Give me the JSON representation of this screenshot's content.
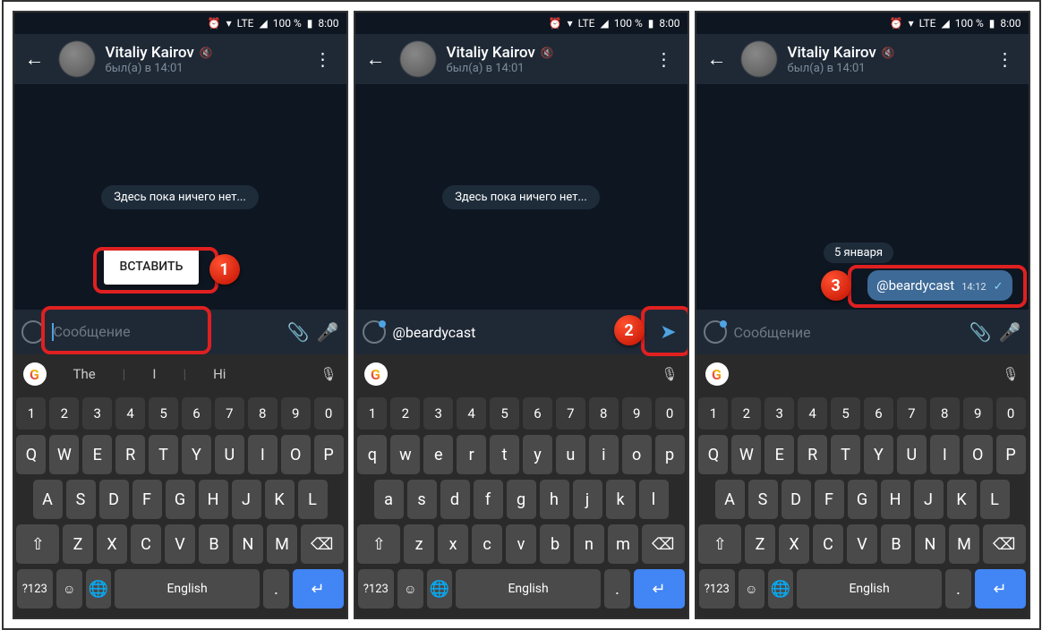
{
  "status": {
    "time": "8:00",
    "battery": "100 %",
    "net": "LTE"
  },
  "header": {
    "name": "Vitaliy Kairov",
    "seen": "был(а) в 14:01"
  },
  "screen1": {
    "empty": "Здесь пока ничего нет...",
    "paste": "ВСТАВИТЬ",
    "placeholder": "Сообщение",
    "badge": "1",
    "sug": [
      "The",
      "I",
      "Hi"
    ]
  },
  "screen2": {
    "empty": "Здесь пока ничего нет...",
    "input": "@beardycast",
    "badge": "2"
  },
  "screen3": {
    "date": "5 января",
    "msg": "@beardycast",
    "msgtime": "14:12",
    "placeholder": "Сообщение",
    "badge": "3"
  },
  "kb": {
    "nums": [
      "1",
      "2",
      "3",
      "4",
      "5",
      "6",
      "7",
      "8",
      "9",
      "0"
    ],
    "r1u": [
      "Q",
      "W",
      "E",
      "R",
      "T",
      "Y",
      "U",
      "I",
      "O",
      "P"
    ],
    "r1l": [
      "q",
      "w",
      "e",
      "r",
      "t",
      "y",
      "u",
      "i",
      "o",
      "p"
    ],
    "r2u": [
      "A",
      "S",
      "D",
      "F",
      "G",
      "H",
      "J",
      "K",
      "L"
    ],
    "r2l": [
      "a",
      "s",
      "d",
      "f",
      "g",
      "h",
      "j",
      "k",
      "l"
    ],
    "r3u": [
      "Z",
      "X",
      "C",
      "V",
      "B",
      "N",
      "M"
    ],
    "r3l": [
      "z",
      "x",
      "c",
      "v",
      "b",
      "n",
      "m"
    ],
    "sym": "?123",
    "lang": "English"
  }
}
